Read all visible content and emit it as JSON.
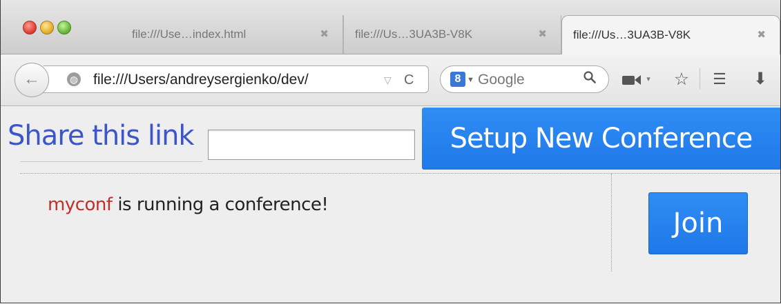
{
  "browser": {
    "tabs": [
      {
        "title": "file:///Use…index.html",
        "close": "✖",
        "active": false
      },
      {
        "title": "file:///Us…3UA3B-V8K",
        "close": "✖",
        "active": false
      },
      {
        "title": "file:///Us…3UA3B-V8K",
        "close": "✖",
        "active": true
      }
    ],
    "address": {
      "back": "←",
      "url": "file:///Users/andreysergienko/dev/",
      "dropdown": "▽",
      "reload": "C"
    },
    "search": {
      "engine_glyph": "8",
      "placeholder": "Google",
      "magnifier": "🔍"
    },
    "toolbar_icons": {
      "camera_caret": "▾",
      "star": "☆",
      "bookmarks": "☰",
      "download": "⬇"
    }
  },
  "page": {
    "share_label": "Share this link",
    "share_input_value": "",
    "setup_button": "Setup New Conference",
    "status": {
      "room": "myconf",
      "message": " is running a conference!"
    },
    "join_button": "Join"
  },
  "colors": {
    "accent": "#1f7ff0",
    "link_label": "#3c56c8",
    "room_name": "#c0302a"
  }
}
